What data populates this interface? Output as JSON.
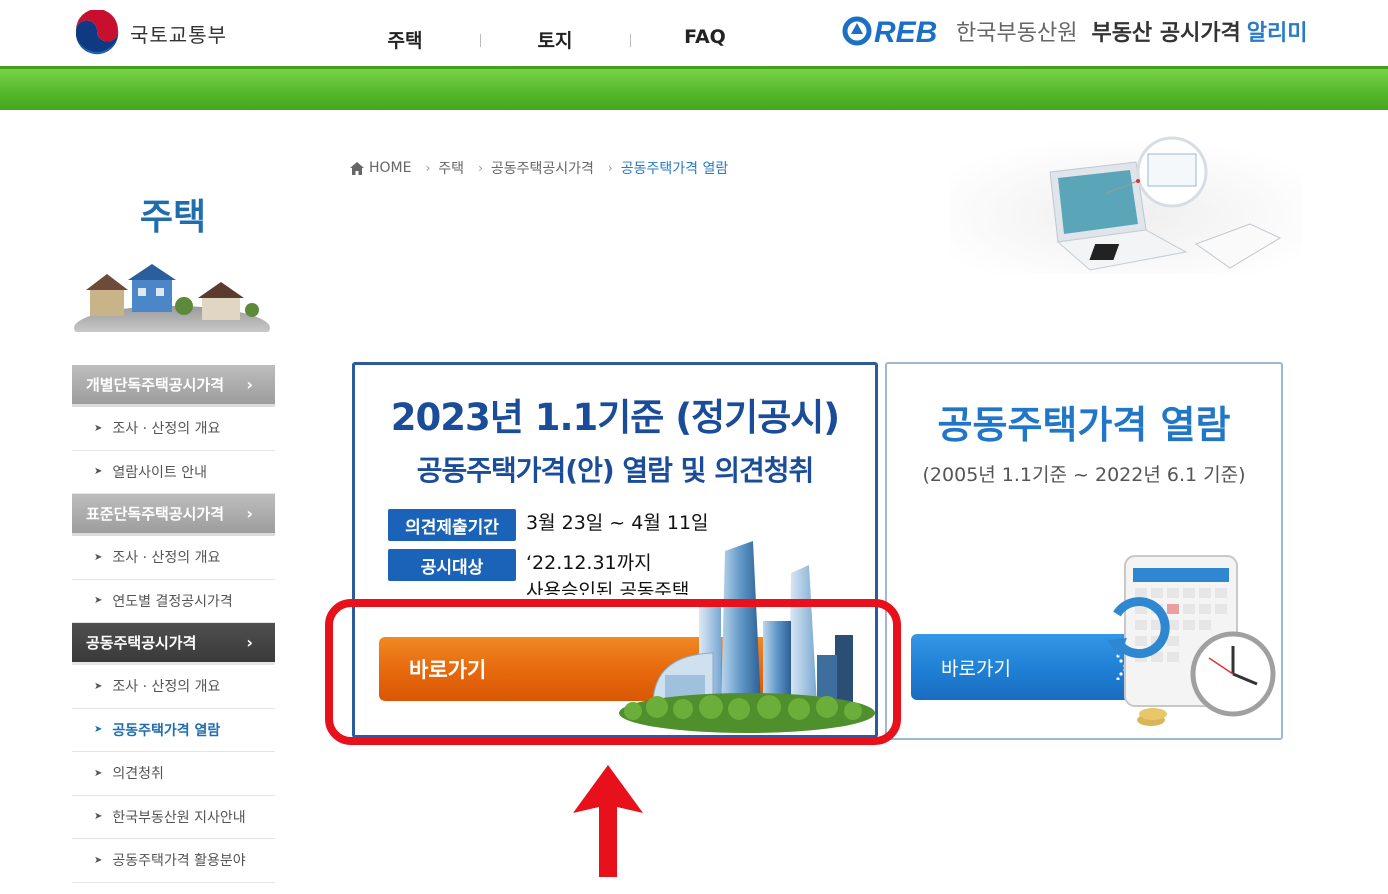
{
  "header": {
    "gov_name": "국토교통부",
    "nav": [
      "주택",
      "토지",
      "FAQ"
    ],
    "reb_mark": "REB",
    "reb_org": "한국부동산원",
    "reb_service": "부동산 공시가격",
    "reb_alim": "알리미"
  },
  "sidebar": {
    "title": "주택",
    "groups": [
      {
        "label": "개별단독주택공시가격",
        "items": [
          "조사 · 산정의 개요",
          "열람사이트 안내"
        ]
      },
      {
        "label": "표준단독주택공시가격",
        "items": [
          "조사 · 산정의 개요",
          "연도별 결정공시가격"
        ]
      },
      {
        "label": "공동주택공시가격",
        "items": [
          "조사 · 산정의 개요",
          "공동주택가격 열람",
          "의견청취",
          "한국부동산원 지사안내",
          "공동주택가격 활용분야"
        ]
      }
    ],
    "chevron": "›"
  },
  "breadcrumb": {
    "home": "HOME",
    "items": [
      "주택",
      "공동주택공시가격",
      "공동주택가격 열람"
    ],
    "sep": "›"
  },
  "notice_card": {
    "title": "2023년 1.1기준 (정기공시)",
    "subtitle": "공동주택가격(안) 열람 및 의견청취",
    "period_label": "의견제출기간",
    "period_value": "3월 23일 ~ 4월 11일",
    "target_label": "공시대상",
    "target_value_1": "‘22.12.31까지",
    "target_value_2": "사용승인된 공동주택",
    "button": "바로가기"
  },
  "view_card": {
    "title": "공동주택가격 열람",
    "period": "(2005년 1.1기준 ~ 2022년 6.1 기준)",
    "button": "바로가기"
  },
  "colors": {
    "brand_green": "#56b92c",
    "brand_blue": "#1a4c99",
    "accent_orange": "#e76a0e",
    "accent_blue": "#1f7fd4",
    "annotation_red": "#e8101a"
  }
}
